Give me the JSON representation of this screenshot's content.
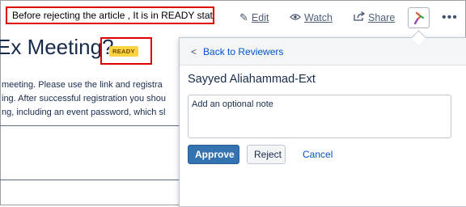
{
  "annotation_note": "Before rejecting the article , It is in READY state",
  "toolbar": {
    "edit_label": "Edit",
    "watch_label": "Watch",
    "share_label": "Share",
    "more_label": "•••",
    "edit_icon": "pencil-icon",
    "watch_icon": "eye-icon",
    "share_icon": "share-icon",
    "workflow_icon": "workflow-icon"
  },
  "page": {
    "title": "Ex Meeting?",
    "status_badge": "READY",
    "body_lines": [
      "meeting. Please use the link and registra",
      "ing. After successful registration you shou",
      "ng, including an event password, which sl"
    ]
  },
  "panel": {
    "back_label": "Back to Reviewers",
    "reviewer_name": "Sayyed Aliahammad-Ext",
    "note_placeholder": "Add an optional note",
    "approve_label": "Approve",
    "reject_label": "Reject",
    "cancel_label": "Cancel"
  },
  "colors": {
    "annotation_border": "#e00000",
    "badge_bg": "#ffd23f",
    "approve_bg": "#3572b0",
    "link": "#0052cc"
  }
}
